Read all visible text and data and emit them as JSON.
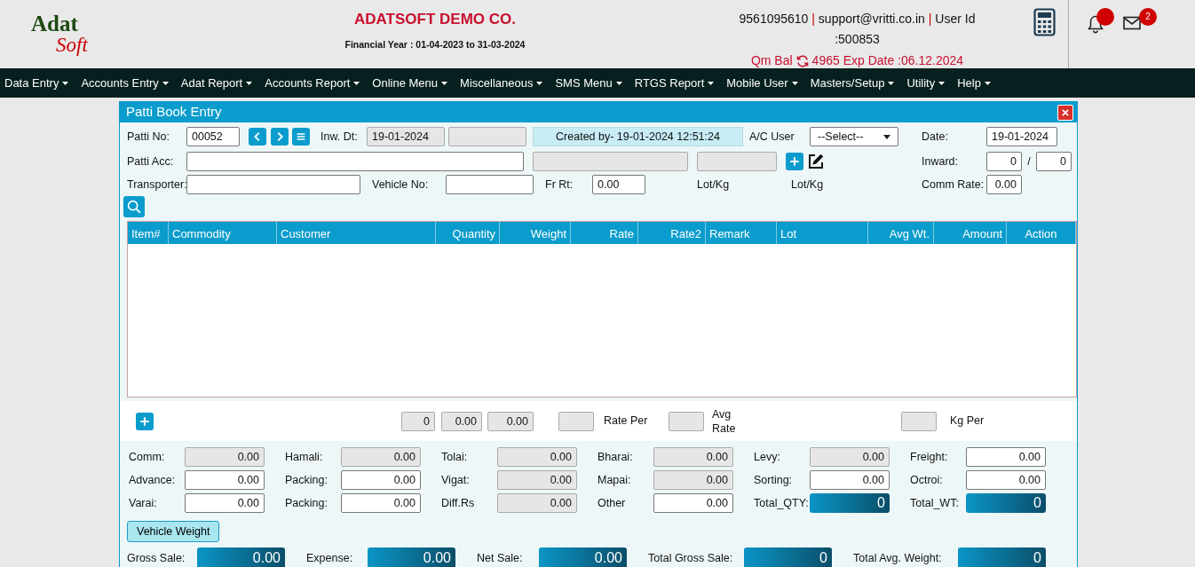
{
  "header": {
    "logo": {
      "top": "Adat",
      "bottom": "Soft"
    },
    "company": "ADATSOFT DEMO CO.",
    "financial_year": "Financial Year : 01-04-2023 to 31-03-2024",
    "contact": [
      {
        "kind": "value",
        "text": "9561095610"
      },
      {
        "kind": "separator",
        "text": "|"
      },
      {
        "kind": "value",
        "text": "support@vritti.co.in"
      },
      {
        "kind": "separator",
        "text": "|"
      },
      {
        "kind": "value",
        "text": "User Id"
      },
      {
        "kind": "value",
        "text": ":500853"
      }
    ],
    "balance": {
      "label": "Qm Bal",
      "value": "4965 Exp Date :06.12.2024"
    },
    "mail_count": "2"
  },
  "menu": [
    "Data Entry",
    "Accounts Entry",
    "Adat Report",
    "Accounts Report",
    "Online Menu",
    "Miscellaneous",
    "SMS Menu",
    "RTGS Report",
    "Mobile User",
    "Masters/Setup",
    "Utility",
    "Help"
  ],
  "dialog": {
    "title": "Patti Book Entry",
    "form_rows": [
      [
        {
          "kind": "label",
          "text": "Patti No:"
        },
        {
          "kind": "input",
          "value": "00052"
        },
        {
          "kind": "prev"
        },
        {
          "kind": "next"
        },
        {
          "kind": "menu"
        },
        {
          "kind": "label",
          "text": "Inw. Dt:"
        },
        {
          "kind": "readonly",
          "value": "19-01-2024"
        },
        {
          "kind": "readonly"
        },
        {
          "kind": "info",
          "text": "Created by- 19-01-2024 12:51:24"
        },
        {
          "kind": "label",
          "text": "A/C User"
        },
        {
          "kind": "select",
          "value": "--Select--"
        },
        {
          "kind": "label",
          "text": "Date:"
        },
        {
          "kind": "input",
          "value": "19-01-2024"
        }
      ],
      [
        {
          "kind": "label",
          "text": "Patti Acc:"
        },
        {
          "kind": "input"
        },
        {
          "kind": "readonly"
        },
        {
          "kind": "readonly"
        },
        {
          "kind": "add"
        },
        {
          "kind": "edit"
        },
        {
          "kind": "label",
          "text": "Inward:"
        },
        {
          "kind": "input",
          "value": "0"
        },
        {
          "kind": "text",
          "text": "/"
        },
        {
          "kind": "input",
          "value": "0"
        }
      ],
      [
        {
          "kind": "label",
          "text": "Transporter:"
        },
        {
          "kind": "input"
        },
        {
          "kind": "label",
          "text": "Vehicle No:"
        },
        {
          "kind": "input"
        },
        {
          "kind": "label",
          "text": "Fr Rt:"
        },
        {
          "kind": "input",
          "value": "0.00"
        },
        {
          "kind": "label",
          "text": "Lot/Kg"
        },
        {
          "kind": "label",
          "text": "Lot/Kg"
        },
        {
          "kind": "label",
          "text": "Comm Rate:"
        },
        {
          "kind": "input",
          "value": "0.00"
        }
      ],
      [
        {
          "kind": "search"
        }
      ]
    ],
    "table": {
      "columns": [
        "Item#",
        "Commodity",
        "Customer",
        "Quantity",
        "Weight",
        "Rate",
        "Rate2",
        "Remark",
        "Lot",
        "Avg Wt.",
        "Amount",
        "Action"
      ]
    },
    "entry_totals": [
      {
        "kind": "add"
      },
      {
        "kind": "readonly",
        "value": "0"
      },
      {
        "kind": "readonly",
        "value": "0.00"
      },
      {
        "kind": "readonly",
        "value": "0.00"
      },
      {
        "kind": "readonly"
      },
      {
        "kind": "label",
        "text": "Rate Per"
      },
      {
        "kind": "readonly"
      },
      {
        "kind": "label",
        "text": "Avg Rate"
      },
      {
        "kind": "readonly"
      },
      {
        "kind": "label",
        "text": "Kg Per"
      }
    ],
    "charges": [
      {
        "label": "Comm:",
        "kind": "readonly",
        "value": "0.00"
      },
      {
        "label": "Hamali:",
        "kind": "readonly",
        "value": "0.00"
      },
      {
        "label": "Tolai:",
        "kind": "readonly",
        "value": "0.00"
      },
      {
        "label": "Bharai:",
        "kind": "readonly",
        "value": "0.00"
      },
      {
        "label": "Levy:",
        "kind": "readonly",
        "value": "0.00"
      },
      {
        "label": "Freight:",
        "kind": "input",
        "value": "0.00"
      },
      {
        "label": "Advance:",
        "kind": "input",
        "value": "0.00"
      },
      {
        "label": "Packing:",
        "kind": "input",
        "value": "0.00"
      },
      {
        "label": "Vigat:",
        "kind": "readonly",
        "value": "0.00"
      },
      {
        "label": "Mapai:",
        "kind": "readonly",
        "value": "0.00"
      },
      {
        "label": "Sorting:",
        "kind": "input",
        "value": "0.00"
      },
      {
        "label": "Octroi:",
        "kind": "input",
        "value": "0.00"
      },
      {
        "label": "Varai:",
        "kind": "input",
        "value": "0.00"
      },
      {
        "label": "Packing:",
        "kind": "input",
        "value": "0.00"
      },
      {
        "label": "Diff.Rs",
        "kind": "readonly",
        "value": "0.00"
      },
      {
        "label": "Other",
        "kind": "input",
        "value": "0.00"
      },
      {
        "label": "Total_QTY:",
        "kind": "total",
        "value": "0"
      },
      {
        "label": "Total_WT:",
        "kind": "total",
        "value": "0"
      }
    ],
    "vehicle_weight_button": "Vehicle Weight",
    "summary": [
      {
        "label": "Gross Sale:",
        "value": "0.00"
      },
      {
        "label": "Expense:",
        "value": "0.00"
      },
      {
        "label": "Net Sale:",
        "value": "0.00"
      },
      {
        "label": "Total Gross Sale:",
        "value": "0"
      },
      {
        "label": "Total Avg. Weight:",
        "value": "0"
      }
    ]
  }
}
